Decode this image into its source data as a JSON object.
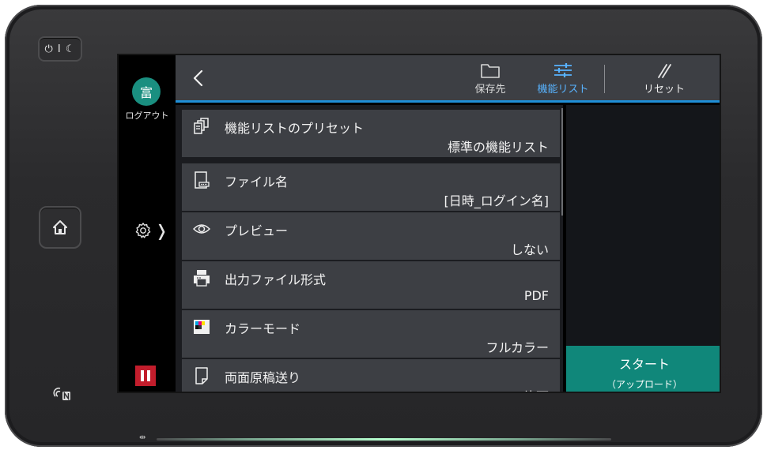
{
  "device": {
    "power_label": "⏻ I ☾",
    "usb_mark": "⇹"
  },
  "left_rail": {
    "avatar_text": "富",
    "logout_label": "ログアウト",
    "settings_chevron": "❭"
  },
  "top_bar": {
    "tabs": [
      {
        "label": "保存先",
        "icon": "folder-icon"
      },
      {
        "label": "機能リスト",
        "icon": "sliders-icon"
      },
      {
        "label": "リセット",
        "icon": "reset-icon"
      }
    ]
  },
  "list": {
    "items": [
      {
        "label": "機能リストのプリセット",
        "value": "標準の機能リスト",
        "icon": "preset-icon"
      },
      {
        "label": "ファイル名",
        "value": "[日時_ログイン名]",
        "icon": "file-name-icon"
      },
      {
        "label": "プレビュー",
        "value": "しない",
        "icon": "eye-icon"
      },
      {
        "label": "出力ファイル形式",
        "value": "PDF",
        "icon": "printer-format-icon"
      },
      {
        "label": "カラーモード",
        "value": "フルカラー",
        "icon": "color-mode-icon"
      },
      {
        "label": "両面原稿送り",
        "value": "片面",
        "icon": "page-icon"
      }
    ]
  },
  "start": {
    "line1": "スタート",
    "line2": "（アップロード）"
  },
  "colors": {
    "accent_blue": "#58b3ff",
    "teal": "#10877a",
    "pause_red": "#c21d2c"
  }
}
